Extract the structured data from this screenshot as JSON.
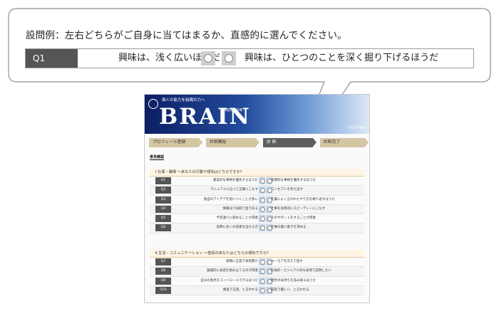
{
  "example": {
    "label": "設問例：左右どちらがご自身に当てはまるか、直感的に選んでください。",
    "question": {
      "number": "Q1",
      "left": "興味は、浅く広いほうだ",
      "right": "興味は、ひとつのことを深く掘り下げるほうだ"
    }
  },
  "app": {
    "banner": {
      "tagline": "個人の能力を組織の力へ",
      "brand": "BRAIN",
      "brand_sub": "社員開発・診断",
      "fortina": "FORTINA"
    },
    "steps": [
      "プロフィール登録",
      "診断開始",
      "診 断",
      "診断完了"
    ],
    "area_title": "意見確認",
    "sections": [
      {
        "title": "Ⅰ.仕事・職場 〜あなたの行動や傾向はどちらですか？",
        "rows": [
          {
            "num": "Q1",
            "left": "着実的な事柄を優先するほうだ",
            "right": "長期的な事柄を優先するほうだ"
          },
          {
            "num": "Q2",
            "left": "マニュアルに沿って正確にこなす",
            "right": "コンセプトを考え出す"
          },
          {
            "num": "Q3",
            "left": "独自のアイデアを思いつくことが多い",
            "right": "先輩によく言われたやり方を繰り返すほうだ"
          },
          {
            "num": "Q4",
            "left": "慎重派で段取り型である",
            "right": "仕事を効率的にスピーディーにこなす"
          },
          {
            "num": "Q5",
            "left": "予定通りに進めることが得意",
            "right": "人のサポートをすることが得意"
          },
          {
            "num": "Q6",
            "left": "実際に多くの成果を出せる方",
            "right": "仕事の量に重きを求める"
          }
        ]
      },
      {
        "title": "Ⅱ.生活・コミュニケーション 〜普段のあなたはどちらの傾向ですか？",
        "rows": [
          {
            "num": "Q7",
            "left": "感情に正直で表現豊か",
            "right": "ユーモアを交えて話す"
          },
          {
            "num": "Q8",
            "left": "論理的に会話を組み立てるのが得意",
            "right": "比喩的・ビジュアル的な表現で説明したい"
          },
          {
            "num": "Q9",
            "left": "自分の意見をコントロールできるほうだ",
            "right": "相手の気持ちを汲み取るほうだ"
          },
          {
            "num": "Q10",
            "left": "素直で正直、と言われる",
            "right": "誠実で優しい、と言われる"
          }
        ]
      }
    ]
  },
  "colors": {
    "number_badge": "#555555",
    "radio_bg_example": "#cfcfcf",
    "radio_bg_app": "#c2d6e8",
    "section_header_bg": "#fff5e5",
    "step_inactive": "#d4c6a3",
    "step_active": "#5e5e5e"
  }
}
